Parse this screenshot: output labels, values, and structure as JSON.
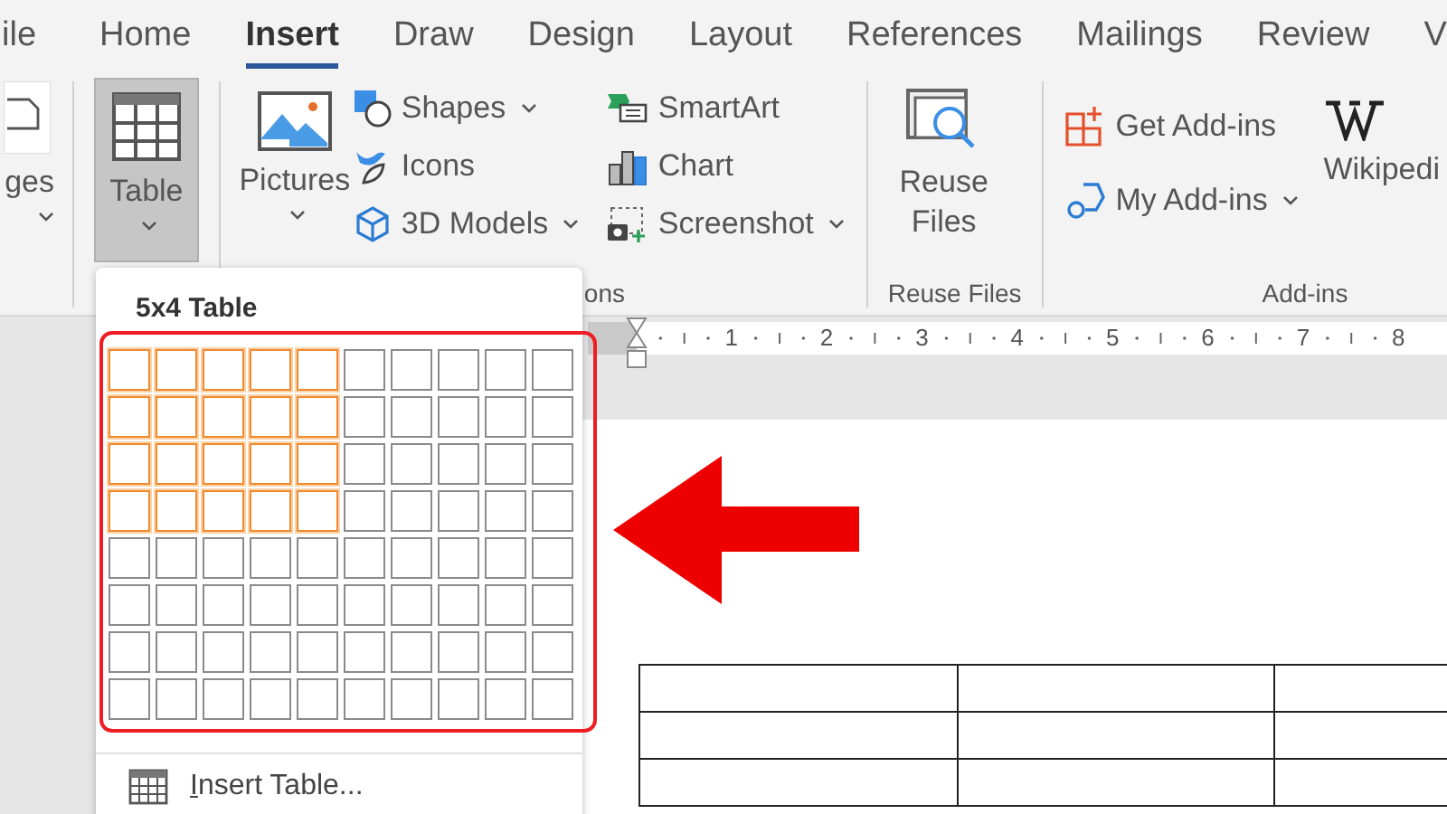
{
  "tabs": [
    {
      "label": "ile",
      "selected": false
    },
    {
      "label": "Home",
      "selected": false
    },
    {
      "label": "Insert",
      "selected": true
    },
    {
      "label": "Draw",
      "selected": false
    },
    {
      "label": "Design",
      "selected": false
    },
    {
      "label": "Layout",
      "selected": false
    },
    {
      "label": "References",
      "selected": false
    },
    {
      "label": "Mailings",
      "selected": false
    },
    {
      "label": "Review",
      "selected": false
    },
    {
      "label": "V",
      "selected": false
    }
  ],
  "ribbon": {
    "pages_button": {
      "label": "ges",
      "dropdown": true
    },
    "table_button": {
      "label": "Table",
      "dropdown": true,
      "selected": true
    },
    "pictures_button": {
      "label": "Pictures",
      "dropdown": true
    },
    "illustrations": [
      {
        "label": "Shapes",
        "dropdown": true
      },
      {
        "label": "Icons",
        "dropdown": false
      },
      {
        "label": "3D Models",
        "dropdown": true
      }
    ],
    "graphics": [
      {
        "label": "SmartArt",
        "dropdown": false
      },
      {
        "label": "Chart",
        "dropdown": false
      },
      {
        "label": "Screenshot",
        "dropdown": true
      }
    ],
    "illustrations_label": "ons",
    "reuse_button": {
      "label": "Reuse Files"
    },
    "reuse_label": "Reuse Files",
    "addins": [
      {
        "label": "Get Add-ins",
        "dropdown": false
      },
      {
        "label": "My Add-ins",
        "dropdown": true
      }
    ],
    "wikipedia_button": {
      "label": "Wikipedi"
    },
    "addins_label": "Add-ins"
  },
  "ruler": {
    "numbers": [
      "1",
      "2",
      "3",
      "4",
      "5",
      "6",
      "7",
      "8"
    ]
  },
  "table_menu": {
    "title": "5x4 Table",
    "grid_rows": [
      {
        "cells": [
          {
            "selected": true
          },
          {
            "selected": true
          },
          {
            "selected": true
          },
          {
            "selected": true
          },
          {
            "selected": true
          },
          {
            "selected": false
          },
          {
            "selected": false
          },
          {
            "selected": false
          },
          {
            "selected": false
          },
          {
            "selected": false
          }
        ]
      },
      {
        "cells": [
          {
            "selected": true
          },
          {
            "selected": true
          },
          {
            "selected": true
          },
          {
            "selected": true
          },
          {
            "selected": true
          },
          {
            "selected": false
          },
          {
            "selected": false
          },
          {
            "selected": false
          },
          {
            "selected": false
          },
          {
            "selected": false
          }
        ]
      },
      {
        "cells": [
          {
            "selected": true
          },
          {
            "selected": true
          },
          {
            "selected": true
          },
          {
            "selected": true
          },
          {
            "selected": true
          },
          {
            "selected": false
          },
          {
            "selected": false
          },
          {
            "selected": false
          },
          {
            "selected": false
          },
          {
            "selected": false
          }
        ]
      },
      {
        "cells": [
          {
            "selected": true
          },
          {
            "selected": true
          },
          {
            "selected": true
          },
          {
            "selected": true
          },
          {
            "selected": true
          },
          {
            "selected": false
          },
          {
            "selected": false
          },
          {
            "selected": false
          },
          {
            "selected": false
          },
          {
            "selected": false
          }
        ]
      },
      {
        "cells": [
          {
            "selected": false
          },
          {
            "selected": false
          },
          {
            "selected": false
          },
          {
            "selected": false
          },
          {
            "selected": false
          },
          {
            "selected": false
          },
          {
            "selected": false
          },
          {
            "selected": false
          },
          {
            "selected": false
          },
          {
            "selected": false
          }
        ]
      },
      {
        "cells": [
          {
            "selected": false
          },
          {
            "selected": false
          },
          {
            "selected": false
          },
          {
            "selected": false
          },
          {
            "selected": false
          },
          {
            "selected": false
          },
          {
            "selected": false
          },
          {
            "selected": false
          },
          {
            "selected": false
          },
          {
            "selected": false
          }
        ]
      },
      {
        "cells": [
          {
            "selected": false
          },
          {
            "selected": false
          },
          {
            "selected": false
          },
          {
            "selected": false
          },
          {
            "selected": false
          },
          {
            "selected": false
          },
          {
            "selected": false
          },
          {
            "selected": false
          },
          {
            "selected": false
          },
          {
            "selected": false
          }
        ]
      },
      {
        "cells": [
          {
            "selected": false
          },
          {
            "selected": false
          },
          {
            "selected": false
          },
          {
            "selected": false
          },
          {
            "selected": false
          },
          {
            "selected": false
          },
          {
            "selected": false
          },
          {
            "selected": false
          },
          {
            "selected": false
          },
          {
            "selected": false
          }
        ]
      }
    ],
    "items": [
      {
        "label": "Insert Table..."
      }
    ]
  }
}
